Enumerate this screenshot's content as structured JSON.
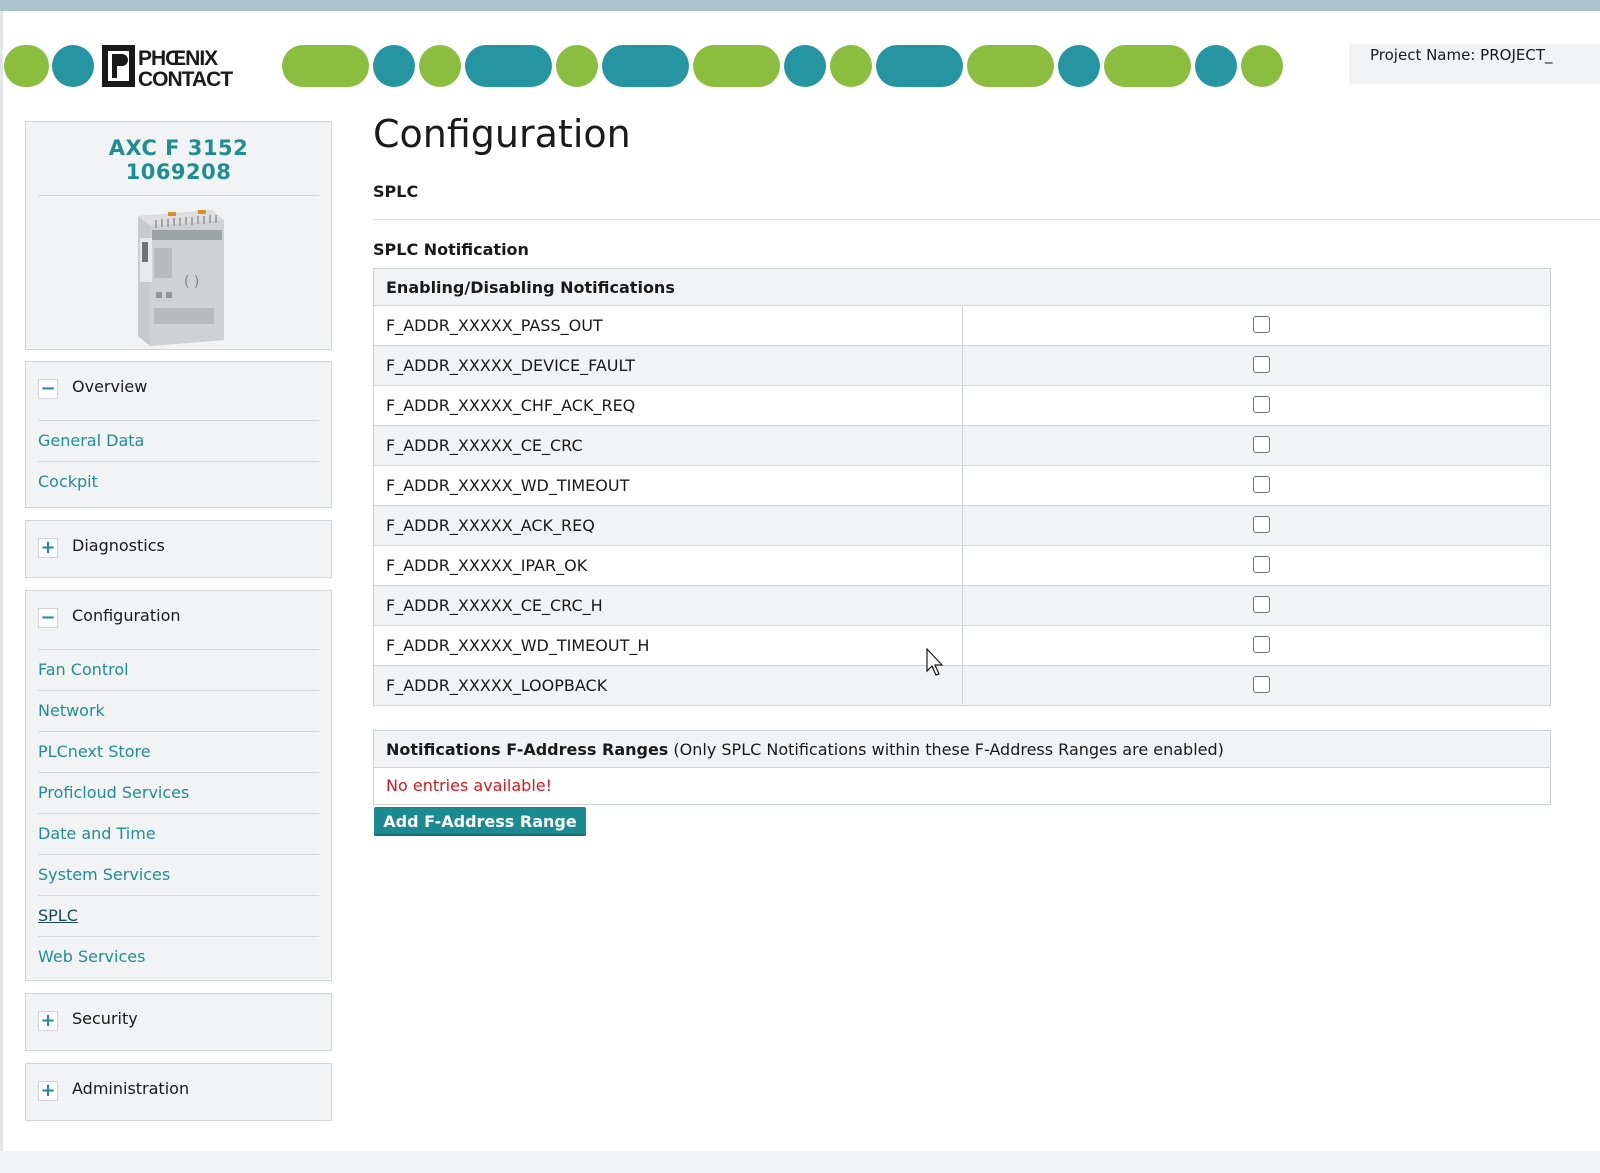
{
  "header": {
    "logo_text": "PHOENIX CONTACT",
    "project_label": "Project Name: PROJECT_",
    "colors": {
      "green": "#8bbd3f",
      "teal": "#2596a1"
    }
  },
  "device": {
    "model": "AXC F 3152",
    "article": "1069208"
  },
  "sidebar": {
    "overview": {
      "toggle": "−",
      "label": "Overview",
      "links": [
        "General Data",
        "Cockpit"
      ]
    },
    "diagnostics": {
      "toggle": "+",
      "label": "Diagnostics"
    },
    "configuration": {
      "toggle": "−",
      "label": "Configuration",
      "links": [
        "Fan Control",
        "Network",
        "PLCnext Store",
        "Proficloud Services",
        "Date and Time",
        "System Services",
        "SPLC",
        "Web Services"
      ],
      "active": "SPLC"
    },
    "security": {
      "toggle": "+",
      "label": "Security"
    },
    "administration": {
      "toggle": "+",
      "label": "Administration"
    }
  },
  "main": {
    "title": "Configuration",
    "section": "SPLC",
    "subsection": "SPLC Notification",
    "notifications": {
      "header": "Enabling/Disabling Notifications",
      "rows": [
        {
          "name": "F_ADDR_XXXXX_PASS_OUT",
          "enabled": false
        },
        {
          "name": "F_ADDR_XXXXX_DEVICE_FAULT",
          "enabled": false
        },
        {
          "name": "F_ADDR_XXXXX_CHF_ACK_REQ",
          "enabled": false
        },
        {
          "name": "F_ADDR_XXXXX_CE_CRC",
          "enabled": false
        },
        {
          "name": "F_ADDR_XXXXX_WD_TIMEOUT",
          "enabled": false
        },
        {
          "name": "F_ADDR_XXXXX_ACK_REQ",
          "enabled": false
        },
        {
          "name": "F_ADDR_XXXXX_IPAR_OK",
          "enabled": false
        },
        {
          "name": "F_ADDR_XXXXX_CE_CRC_H",
          "enabled": false
        },
        {
          "name": "F_ADDR_XXXXX_WD_TIMEOUT_H",
          "enabled": false
        },
        {
          "name": "F_ADDR_XXXXX_LOOPBACK",
          "enabled": false
        }
      ]
    },
    "ranges": {
      "header_bold": "Notifications F-Address Ranges",
      "header_note": "(Only SPLC Notifications within these F-Address Ranges are enabled)",
      "empty": "No entries available!",
      "add_button": "Add F-Address Range"
    }
  }
}
